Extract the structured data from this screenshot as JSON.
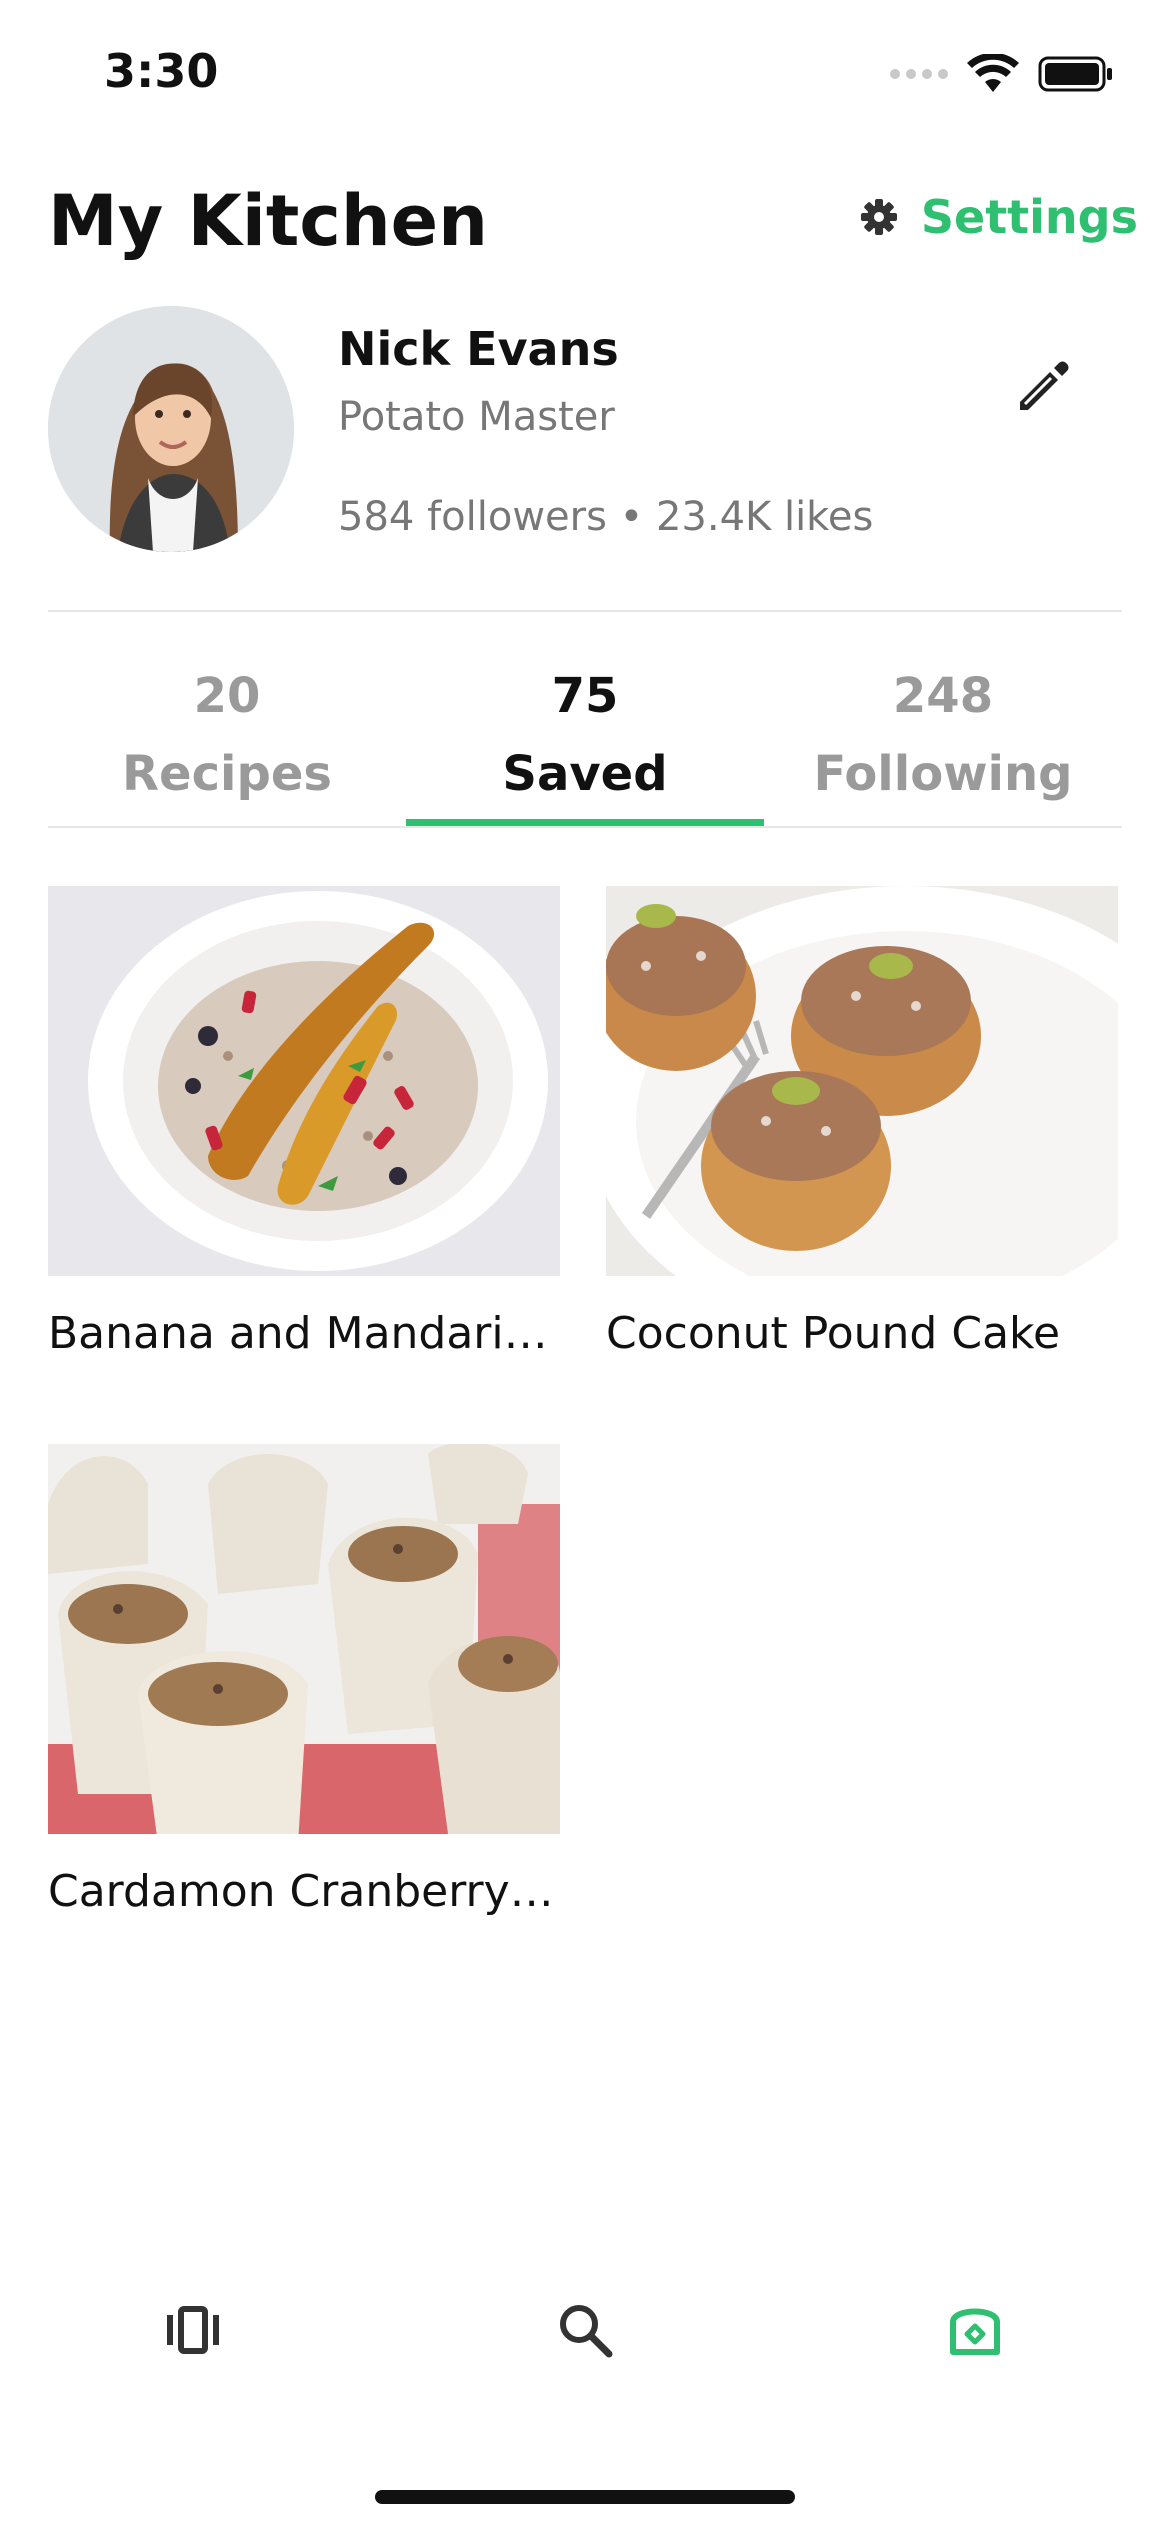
{
  "status_bar": {
    "time": "3:30"
  },
  "header": {
    "title": "My Kitchen",
    "settings_label": "Settings"
  },
  "profile": {
    "name": "Nick Evans",
    "title": "Potato Master",
    "stats": "584 followers • 23.4K likes"
  },
  "tabs": [
    {
      "count": "20",
      "label": "Recipes",
      "active": false
    },
    {
      "count": "75",
      "label": "Saved",
      "active": true
    },
    {
      "count": "248",
      "label": "Following",
      "active": false
    }
  ],
  "recipes": [
    {
      "title": "Banana and Mandarin Buckwheat Porridge",
      "display_title": "Banana and Mandarin..."
    },
    {
      "title": "Coconut Pound Cake",
      "display_title": "Coconut Pound Cake"
    },
    {
      "title": "Cardamon Cranberry Pork Dumplings",
      "display_title": "Cardamon Cranberry ..."
    }
  ],
  "bottom_nav": [
    {
      "icon": "carousel-icon",
      "active": false
    },
    {
      "icon": "search-icon",
      "active": false
    },
    {
      "icon": "kitchen-toaster-icon",
      "active": true
    }
  ],
  "colors": {
    "accent": "#2fbf71",
    "text": "#111111",
    "muted": "#777777",
    "tab_inactive": "#9a9a9a"
  }
}
